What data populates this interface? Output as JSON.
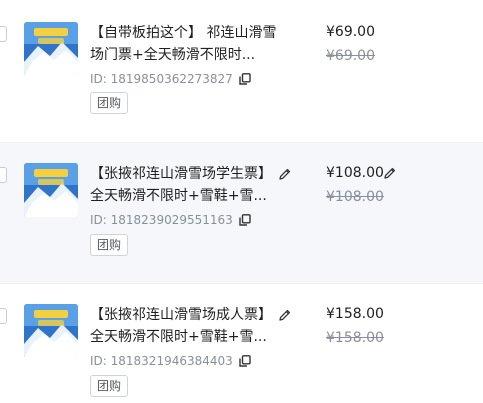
{
  "products": [
    {
      "title": "【自带板拍这个】 祁连山滑雪场门票+全天畅滑不限时...",
      "id": "ID: 1819850362273827",
      "tag": "团购",
      "price": "¥69.00",
      "original_price": "¥69.00",
      "title_editable": false,
      "price_editable": false
    },
    {
      "title": "【张掖祁连山滑雪场学生票】 全天畅滑不限时+雪鞋+雪...",
      "id": "ID: 1818239029551163",
      "tag": "团购",
      "price": "¥108.00",
      "original_price": "¥108.00",
      "title_editable": true,
      "price_editable": true
    },
    {
      "title": "【张掖祁连山滑雪场成人票】 全天畅滑不限时+雪鞋+雪...",
      "id": "ID: 1818321946384403",
      "tag": "团购",
      "price": "¥158.00",
      "original_price": "¥158.00",
      "title_editable": true,
      "price_editable": false
    }
  ],
  "colors": {
    "selected_row_bg": "#f5f7fb",
    "text_primary": "#1f1f1f",
    "text_secondary": "#8a8f99",
    "thumb_sky": "#2f74c8"
  },
  "icons": {
    "copy": "copy-icon",
    "edit": "pencil-icon"
  }
}
